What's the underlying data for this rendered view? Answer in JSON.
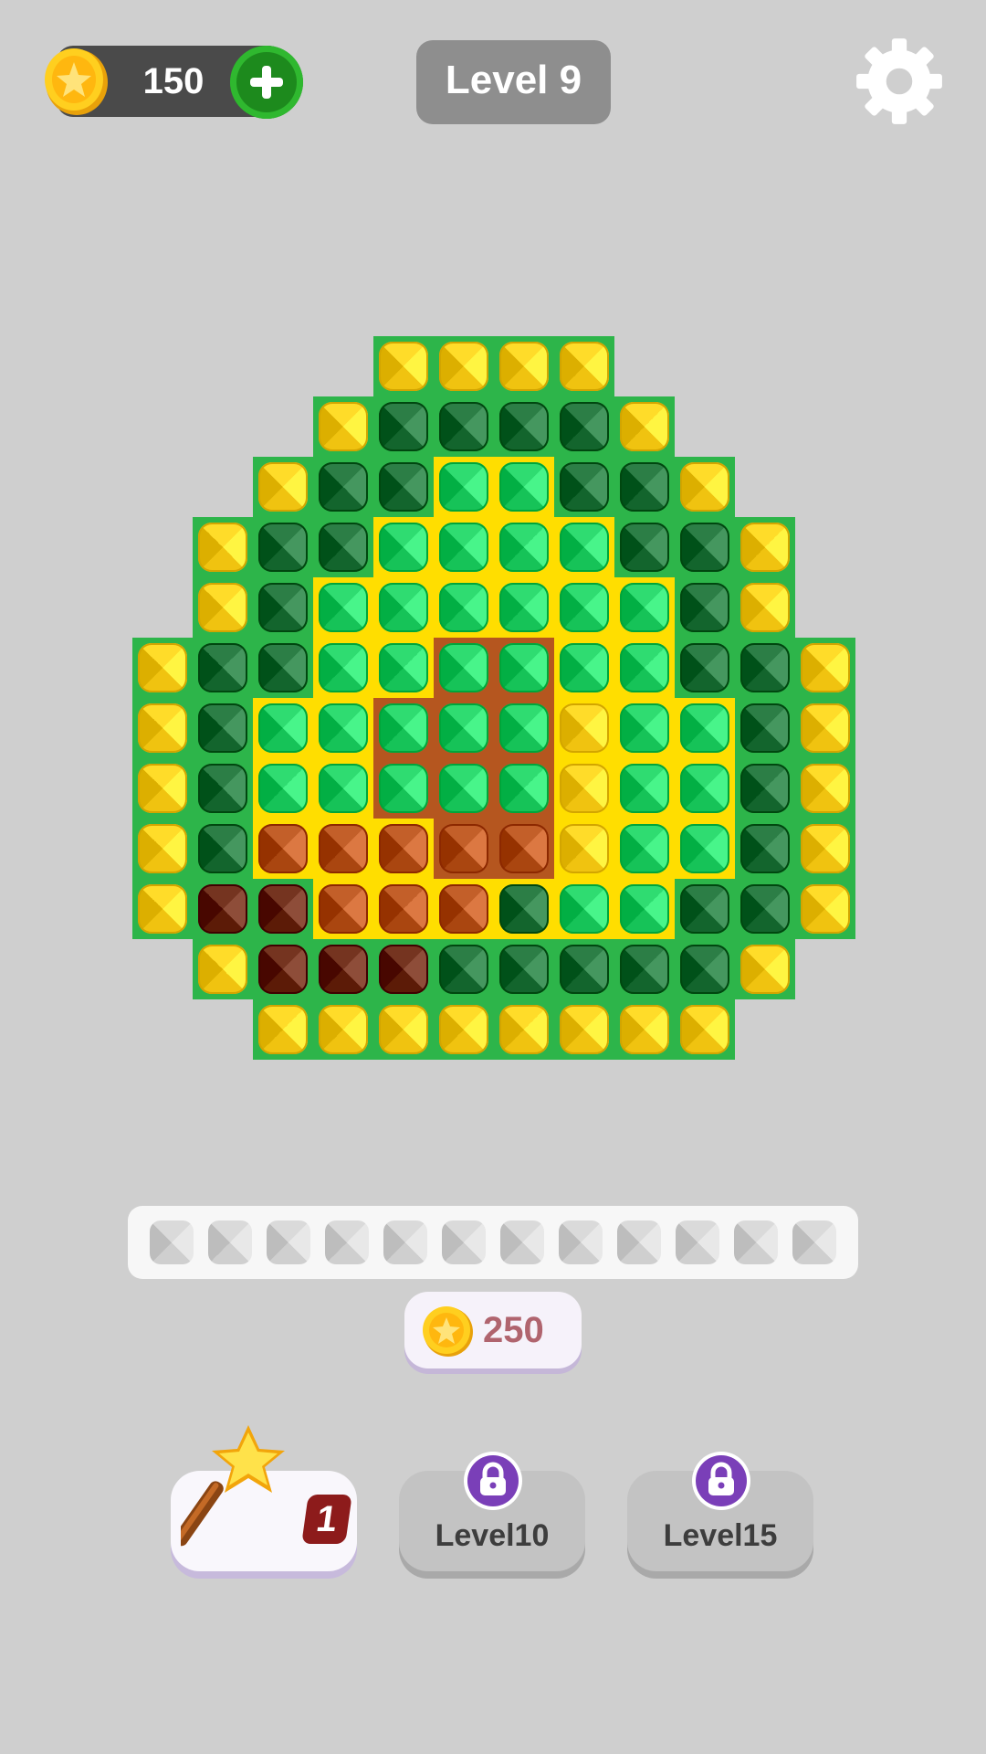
{
  "header": {
    "coins": "150",
    "level_title": "Level 9"
  },
  "colors": {
    "Y": "#ffd21f",
    "D": "#22743c",
    "G": "#25d267",
    "O": "#b9551f",
    "B": "#6b2a16",
    "bg_green": "#2db54a",
    "bg_yellow": "#ffde00",
    "bg_orange": "#b5561f",
    "bg_brown": "#6e2f16"
  },
  "board": {
    "rows": [
      "....YYYY....",
      "...YDDDDY...",
      "..YDDGGDDY..",
      ".YDDGGGGDDY.",
      ".YDGGGGGGDY.",
      "YDDGGGGGGDDY",
      "YDGGGGGYGGDY",
      "YDGGGGGYGGDY",
      "YDOOOOOYGGDY",
      "YBBOOODGGDDY",
      ".YBBBDDDDDY.",
      "..YYYYYYYY.."
    ],
    "background": [
      "....gggg....",
      "...gggggg...",
      "..gggyyggg..",
      ".gggyyyyggg.",
      ".ggyyyyyygg.",
      "gggyyooyyggg",
      "ggyyoooyyygg",
      "ggyyoooyyygg",
      "ggyyyooyyygg",
      "gggyyyyyyggg",
      ".gggggggggg.",
      "..gggggggg.."
    ]
  },
  "tray": {
    "slot_count": 12
  },
  "cost": {
    "amount": "250"
  },
  "boosters": [
    {
      "type": "magic-wand",
      "count": "1",
      "locked": false
    },
    {
      "label": "Level10",
      "locked": true
    },
    {
      "label": "Level15",
      "locked": true
    }
  ]
}
